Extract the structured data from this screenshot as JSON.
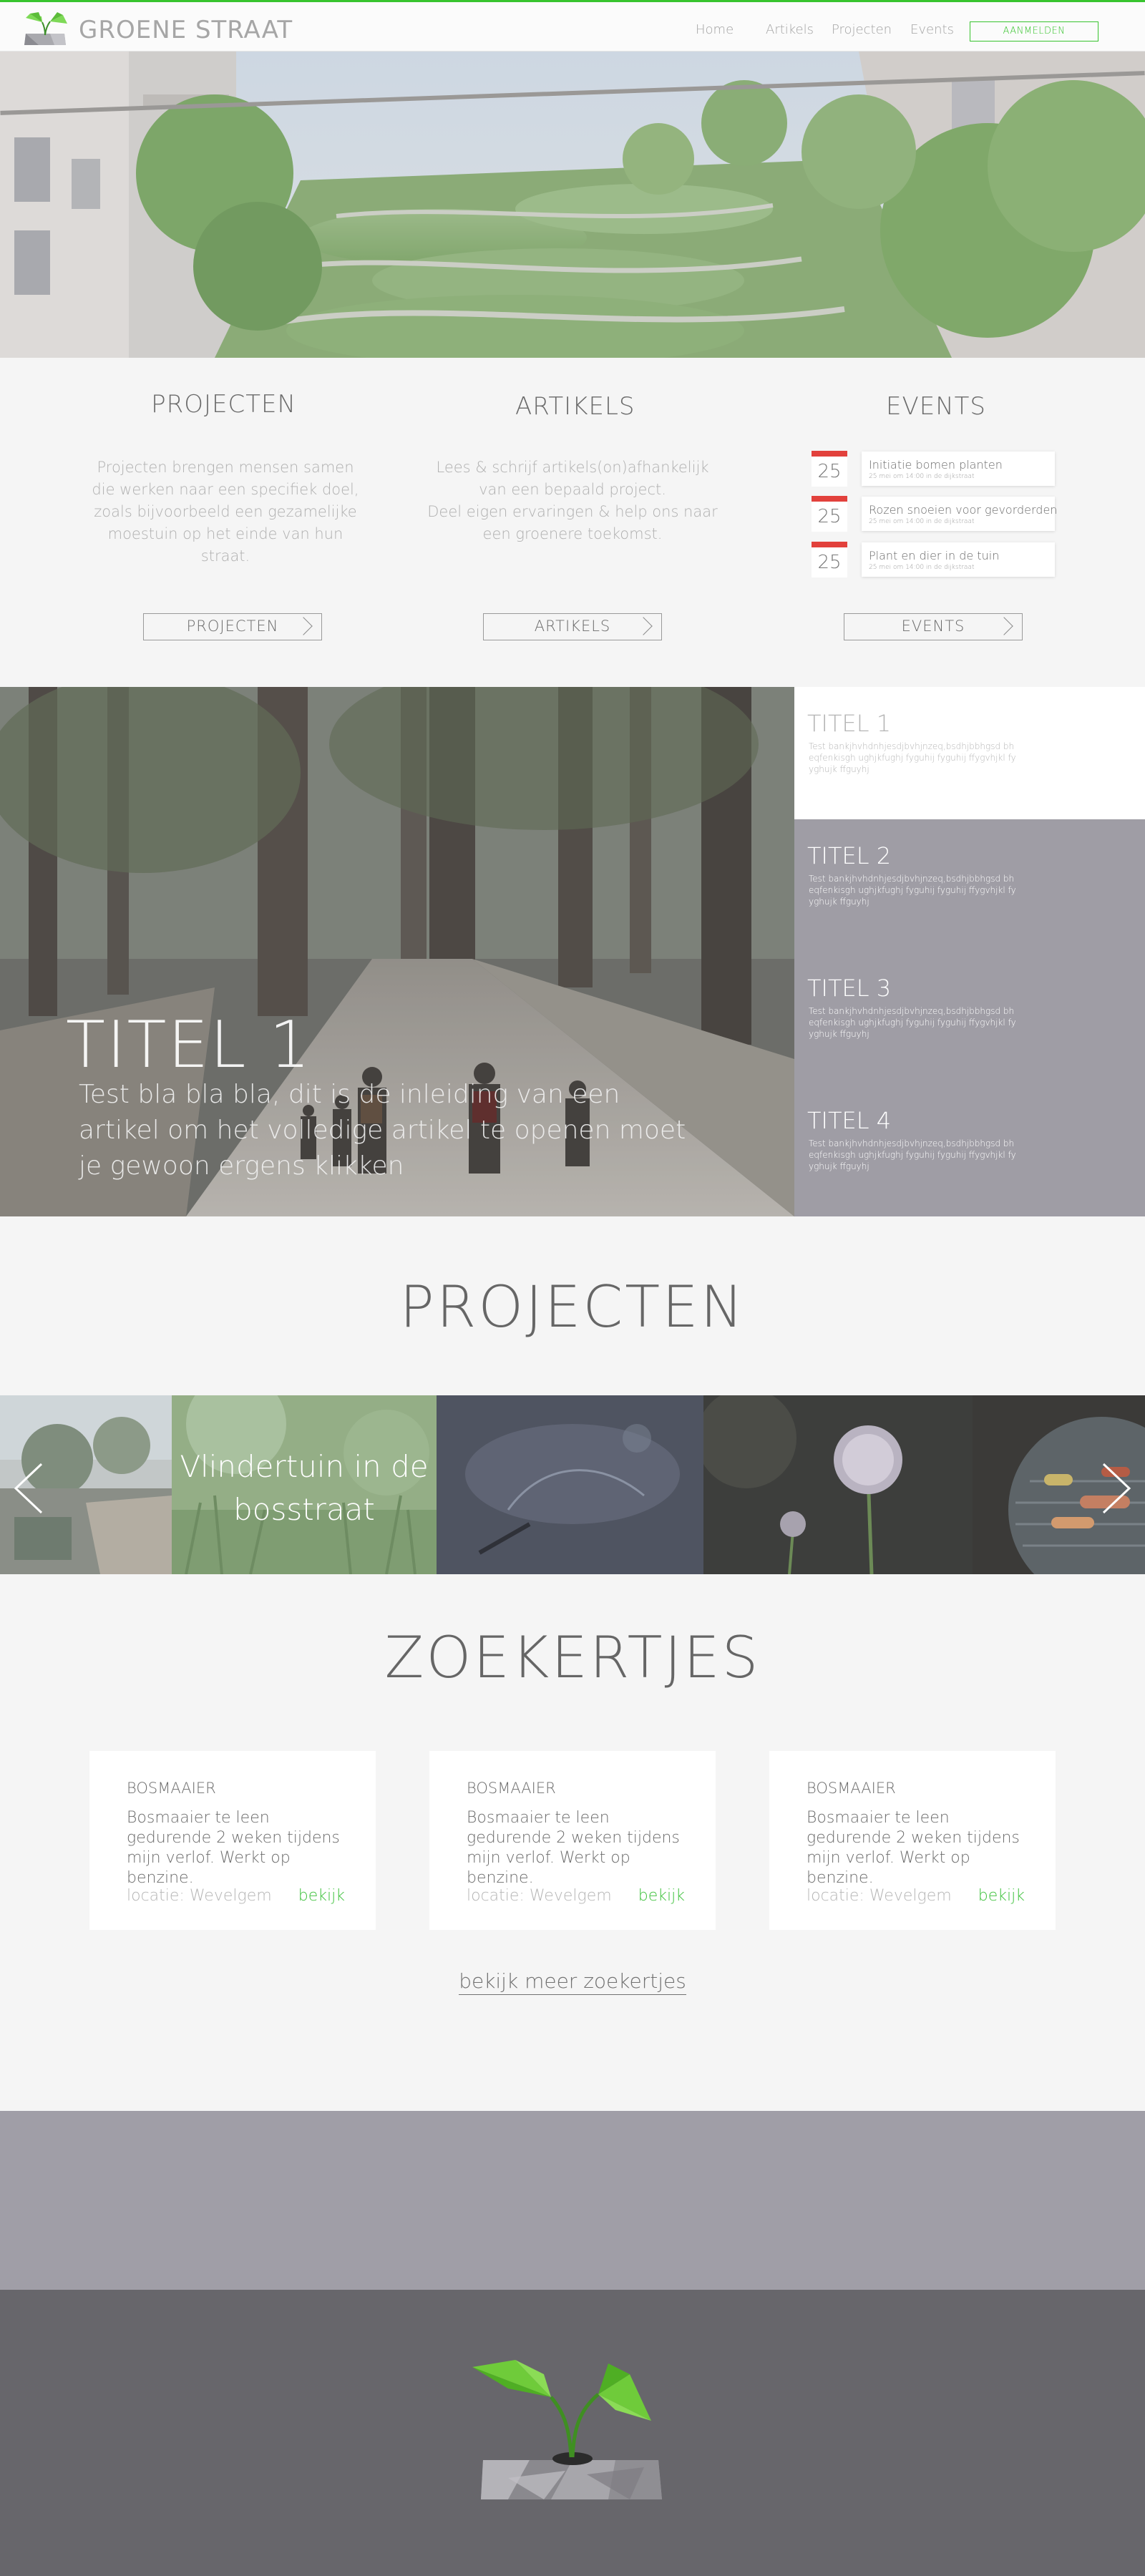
{
  "header": {
    "brand": "GROENE STRAAT",
    "nav": [
      "Home",
      "Artikels",
      "Projecten",
      "Events"
    ],
    "login": "AANMELDEN"
  },
  "intro": {
    "projecten": {
      "title": "PROJECTEN",
      "text": [
        "Projecten brengen mensen samen",
        "die werken naar een specifiek doel,",
        "zoals bijvoorbeeld een gezamelijke",
        "moestuin op het einde van hun straat."
      ],
      "button": "PROJECTEN"
    },
    "artikels": {
      "title": "ARTIKELS",
      "text": [
        "Lees & schrijf artikels(on)afhankelijk",
        "van een bepaald project.",
        "Deel eigen ervaringen & help ons naar",
        "een groenere toekomst."
      ],
      "button": "ARTIKELS"
    },
    "events": {
      "title": "EVENTS",
      "items": [
        {
          "day": "25",
          "title": "Initiatie bomen planten",
          "sub": "25 mei om 14:00 in de dijkstraat"
        },
        {
          "day": "25",
          "title": "Rozen snoeien voor gevorderden",
          "sub": "25 mei om 14:00 in de dijkstraat"
        },
        {
          "day": "25",
          "title": "Plant en dier in de tuin",
          "sub": "25 mei om 14:00 in de dijkstraat"
        }
      ],
      "button": "EVENTS"
    }
  },
  "articles": {
    "featured": {
      "title": "TITEL 1",
      "text": "Test bla bla bla, dit is de inleiding van een artikel om het volledige artikel te openen moet je gewoon ergens klikken"
    },
    "list": [
      {
        "title": "TITEL 1",
        "text": "Test bankjhvhdnhjesdjbvhjnzeq,bsdhjbbhgsd bheqfenkisgh ughjkfughj fyguhij fyguhij ffygvhjkl fyyghujk ffguyhj"
      },
      {
        "title": "TITEL 2",
        "text": "Test bankjhvhdnhjesdjbvhjnzeq,bsdhjbbhgsd bheqfenkisgh ughjkfughj fyguhij fyguhij ffygvhjkl fyyghujk ffguyhj"
      },
      {
        "title": "TITEL 3",
        "text": "Test bankjhvhdnhjesdjbvhjnzeq,bsdhjbbhgsd bheqfenkisgh ughjkfughj fyguhij fyguhij ffygvhjkl fyyghujk ffguyhj"
      },
      {
        "title": "TITEL 4",
        "text": "Test bankjhvhdnhjesdjbvhjnzeq,bsdhjbbhgsd bheqfenkisgh ughjkfughj fyguhij fyguhij ffygvhjkl fyyghujk ffguyhj"
      }
    ]
  },
  "projects": {
    "heading": "PROJECTEN",
    "tile_label": "Vlindertuin in de bosstraat",
    "prev_icon": "chevron-left-icon",
    "next_icon": "chevron-right-icon"
  },
  "classifieds": {
    "heading": "ZOEKERTJES",
    "items": [
      {
        "title": "BOSMAAIER",
        "desc": "Bosmaaier te leen gedurende 2 weken tijdens mijn verlof. Werkt op benzine.",
        "location": "locatie: Wevelgem",
        "link": "bekijk"
      },
      {
        "title": "BOSMAAIER",
        "desc": "Bosmaaier te leen gedurende 2 weken tijdens mijn verlof. Werkt op benzine.",
        "location": "locatie: Wevelgem",
        "link": "bekijk"
      },
      {
        "title": "BOSMAAIER",
        "desc": "Bosmaaier te leen gedurende 2 weken tijdens mijn verlof. Werkt op benzine.",
        "location": "locatie: Wevelgem",
        "link": "bekijk"
      }
    ],
    "more": "bekijk meer zoekertjes"
  },
  "colors": {
    "brand_green": "#38c42e",
    "event_red": "#e2413c",
    "link_green": "#3cc13a",
    "article_panel": "#9f9da5",
    "footer_dark": "#67666b"
  }
}
